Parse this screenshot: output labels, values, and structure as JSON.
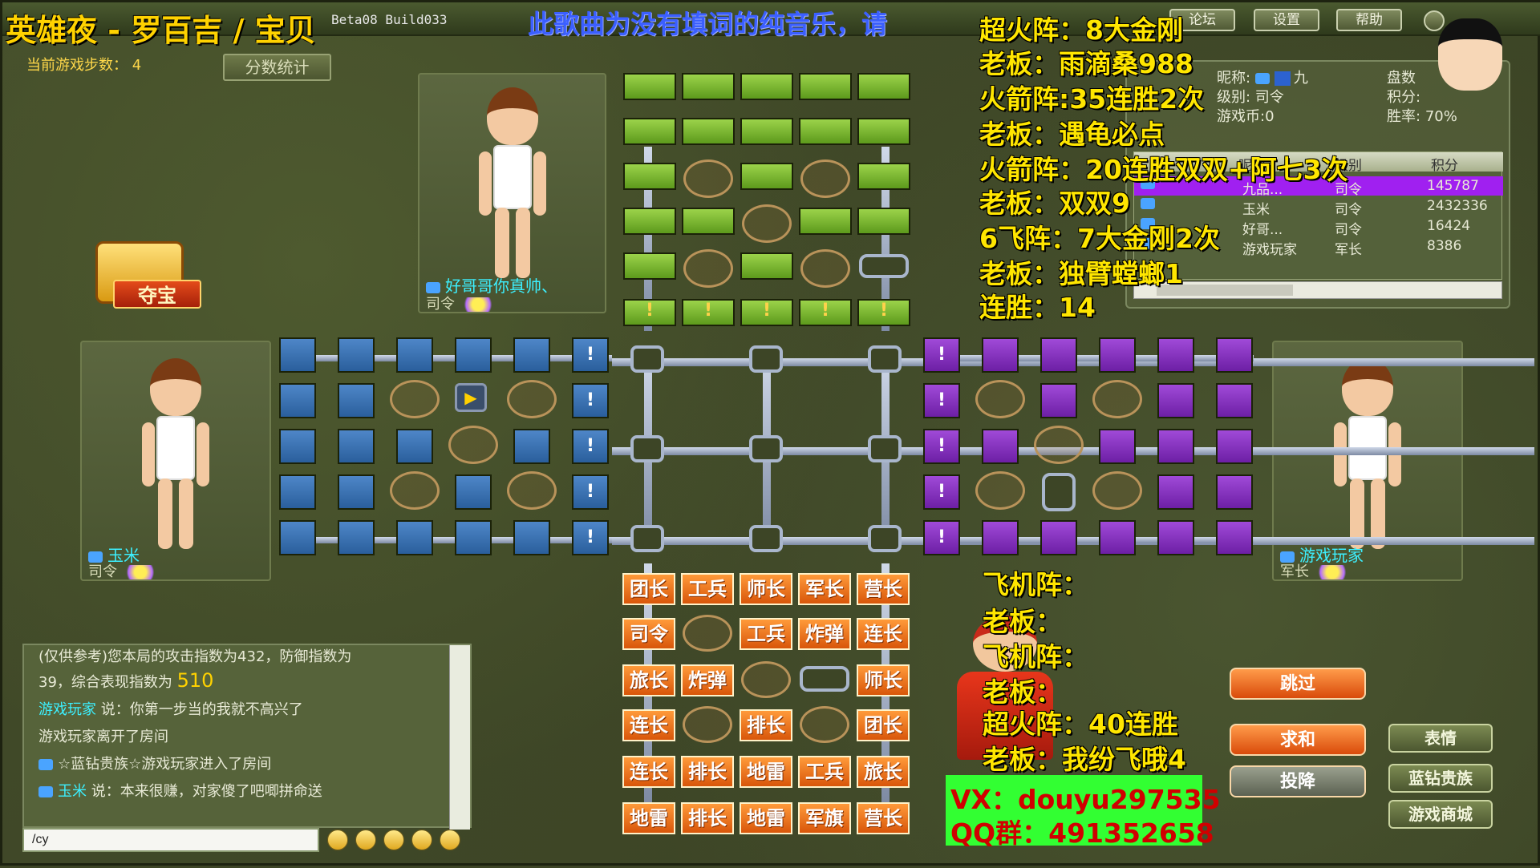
{
  "overlay": {
    "title": "英雄夜 - 罗百吉 / 宝贝",
    "build": "Beta08 Build033",
    "marquee": "此歌曲为没有填词的纯音乐，请",
    "lines_top": [
      "超火阵：8大金刚",
      "老板：雨滴桑988",
      "火箭阵:35连胜2次",
      "老板：遇龟必点",
      "火箭阵：20连胜双双+阿七3次",
      "老板：双双9",
      "6飞阵：7大金刚2次",
      "老板：独臂螳螂1",
      "连胜：14"
    ],
    "lines_bottom": [
      "飞机阵：",
      "老板：",
      "飞机阵：",
      "老板：",
      "超火阵：40连胜",
      "老板：我纷飞哦4"
    ],
    "contact_vx": "VX：douyu297535",
    "contact_qq": "QQ群：491352658"
  },
  "topbar": {
    "forum": "论坛",
    "settings": "设置",
    "help": "帮助"
  },
  "status": {
    "steps": "当前游戏步数： 4",
    "score_button": "分数统计",
    "treasure": "夺宝"
  },
  "players": {
    "top": {
      "name": "好哥哥你真帅、",
      "rank": "司令"
    },
    "left": {
      "name": "玉米",
      "rank": "司令"
    },
    "right": {
      "name": "游戏玩家",
      "rank": "军长"
    }
  },
  "pieces": [
    [
      "团长",
      "工兵",
      "师长",
      "军长",
      "营长"
    ],
    [
      "司令",
      "",
      "工兵",
      "炸弹",
      "连长"
    ],
    [
      "旅长",
      "炸弹",
      "",
      "",
      "师长"
    ],
    [
      "连长",
      "",
      "排长",
      "",
      "团长"
    ],
    [
      "连长",
      "排长",
      "地雷",
      "工兵",
      "旅长"
    ],
    [
      "地雷",
      "排长",
      "地雷",
      "军旗",
      "营长"
    ]
  ],
  "mark": "!",
  "info": {
    "nick_label": "昵称:",
    "nick_value": "九",
    "level": "级别: 司令",
    "coins": "游戏币:0",
    "games_label": "盘数",
    "points_label": "积分:",
    "winrate_label": "胜率:",
    "winrate_value": "70%",
    "rank_headers": [
      "昵称",
      "级别",
      "积分"
    ],
    "rank_rows": [
      {
        "name": "九品...",
        "level": "司令",
        "score": "145787"
      },
      {
        "name": "玉米",
        "level": "司令",
        "score": "2432336"
      },
      {
        "name": "好哥...",
        "level": "司令",
        "score": "16424"
      },
      {
        "name": "游戏玩家",
        "level": "军长",
        "score": "8386"
      }
    ]
  },
  "chat": {
    "lines": [
      "(仅供参考)您本局的攻击指数为432，防御指数为",
      "39，综合表现指数为",
      "说：你第一步当的我就不高兴了",
      "游戏玩家离开了房间",
      "☆蓝钻贵族☆游戏玩家进入了房间",
      "说：本来很赚，对家傻了吧唧拼命送"
    ],
    "score_value": "510",
    "who1": "游戏玩家",
    "who2": "玉米",
    "input_value": "/cy"
  },
  "actions": {
    "skip": "跳过",
    "draw": "求和",
    "surrender": "投降",
    "emote": "表情",
    "bluediamond": "蓝钻贵族",
    "shop": "游戏商城"
  },
  "colors": {
    "green_side": "#7cbb2e",
    "blue_side": "#3a72b4",
    "purple_side": "#8a32c2",
    "orange_piece": "#f07a22"
  }
}
